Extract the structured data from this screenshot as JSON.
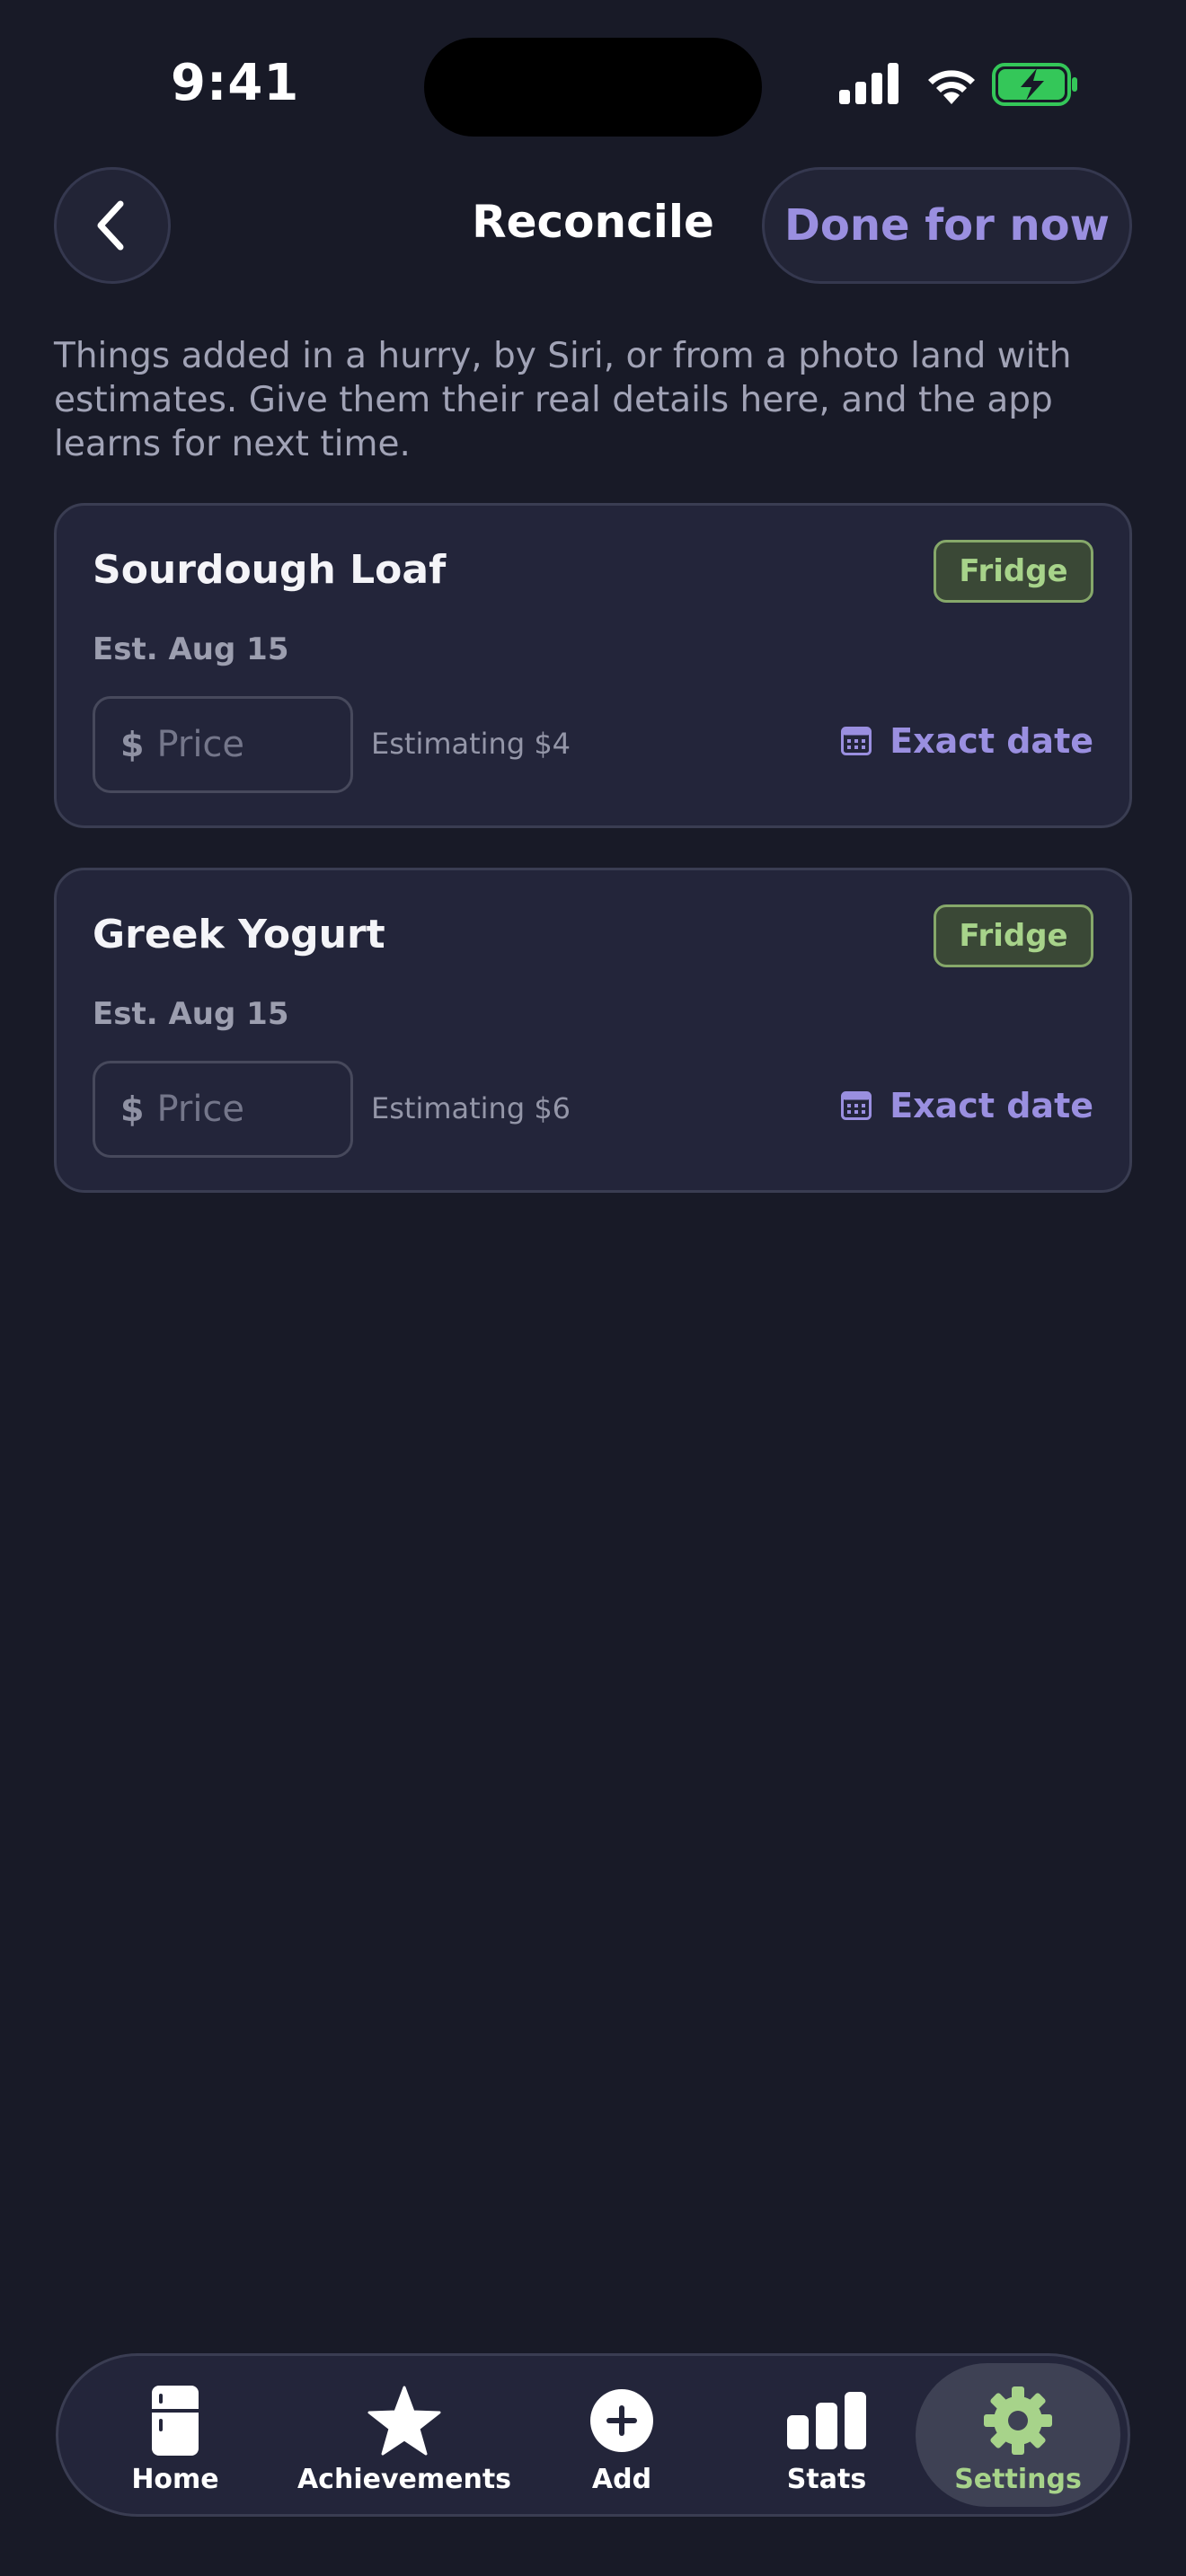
{
  "status_bar": {
    "time": "9:41",
    "battery_color": "#34C759"
  },
  "header": {
    "title": "Reconcile",
    "done_label": "Done for now",
    "back_icon": "chevron-left-icon"
  },
  "intro_text": "Things added in a hurry, by Siri, or from a photo land with estimates. Give them their real details here, and the app learns for next time.",
  "items": [
    {
      "name": "Sourdough Loaf",
      "location": "Fridge",
      "est_date": "Est. Aug 15",
      "currency": "$",
      "price_placeholder": "Price",
      "price_value": "",
      "estimate_hint": "Estimating $4",
      "exact_date_label": "Exact date"
    },
    {
      "name": "Greek Yogurt",
      "location": "Fridge",
      "est_date": "Est. Aug 15",
      "currency": "$",
      "price_placeholder": "Price",
      "price_value": "",
      "estimate_hint": "Estimating $6",
      "exact_date_label": "Exact date"
    }
  ],
  "tabbar": {
    "active": "Settings",
    "tabs": [
      {
        "label": "Home",
        "icon": "fridge-icon"
      },
      {
        "label": "Achievements",
        "icon": "star-icon"
      },
      {
        "label": "Add",
        "icon": "plus-circle-icon"
      },
      {
        "label": "Stats",
        "icon": "bar-chart-icon"
      },
      {
        "label": "Settings",
        "icon": "gear-icon"
      }
    ]
  },
  "colors": {
    "background": "#181A27",
    "card": "#23253A",
    "accent": "#9A8FE0",
    "location_badge": "#A7D38A",
    "active_tab": "#A7D38A"
  }
}
